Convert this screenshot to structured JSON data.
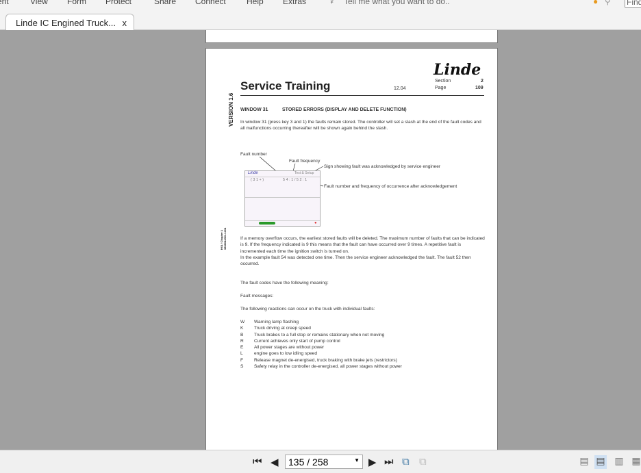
{
  "menu": [
    "ent",
    "View",
    "Form",
    "Protect",
    "Share",
    "Connect",
    "Help",
    "Extras"
  ],
  "tell_me": "Tell me what you want to do..",
  "find_placeholder": "Find",
  "tab": {
    "title": "Linde IC Engined Truck...",
    "close": "x"
  },
  "doc": {
    "logo": "Linde",
    "title": "Service Training",
    "date": "12.04",
    "section_label": "Section",
    "section": "2",
    "page_label": "Page",
    "page": "109",
    "version": "VERSION 1.6",
    "side_ref": "H01 / Chapter 1 3808044301.1204",
    "heading_num": "WINDOW 31",
    "heading": "STORED ERRORS (DISPLAY AND DELETE FUNCTION)",
    "intro": "In window 31 (press key 3 and 1) the faults remain stored. The controller will set a slash at the end of the fault codes and all malfunctions occurring thereafter will be shown again behind the slash.",
    "fig": {
      "fault_number": "Fault number",
      "fault_frequency": "Fault frequency",
      "sign": "Sign showing fault was acknowledged by service engineer",
      "after": "Fault number and frequency of occurrence after acknowledgement",
      "screen_logo": "Linde",
      "screen_title": "Test & Setup",
      "screen_left": "( 3 1 + )",
      "screen_codes": "5 4 :  1  / 5 2 :  1"
    },
    "para1": "If a memory overflow occurs, the earliest stored faults will be deleted. The maximum number of faults that can be indicated is 9. If the frequency indicated is 9 this means that the fault can have occurred over 9 times. A repetitive fault is incremented each time the ignition switch is turned on.",
    "para2": "In the example fault 54 was detected one time. Then the service engineer acknowledged the fault. The fault 52 then occurred.",
    "meaning": "The fault codes have the following meaning:",
    "messages": "Fault messages:",
    "reactions": "The following reactions can occur on the truck with individual faults:",
    "codes": [
      {
        "k": "W",
        "v": "Warning lamp flashing"
      },
      {
        "k": "K",
        "v": "Truck driving at creep speed"
      },
      {
        "k": "B",
        "v": "Truck brakes to a full stop or remains stationary when not moving"
      },
      {
        "k": "R",
        "v": "Current achieves only start of pump control"
      },
      {
        "k": "E",
        "v": "All power stages are without power"
      },
      {
        "k": "L",
        "v": "engine goes to low idling speed"
      },
      {
        "k": "F",
        "v": "Release magnet de-energised, truck braking with brake jets (restrictors)"
      },
      {
        "k": "S",
        "v": "Safety relay in the controller de-energised, all power stages without power"
      }
    ]
  },
  "toolbar": {
    "page_value": "135 / 258"
  }
}
